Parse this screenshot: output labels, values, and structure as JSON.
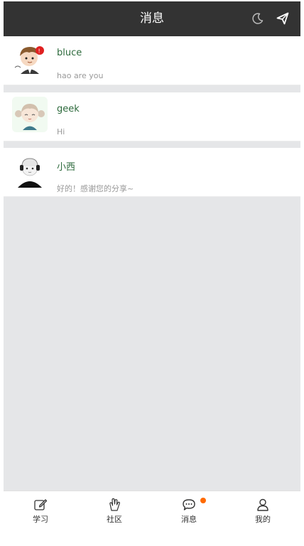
{
  "header": {
    "title": "消息",
    "night_icon": "moon-icon",
    "send_icon": "paper-plane-icon"
  },
  "messages": [
    {
      "name": "bluce",
      "preview": "hao are you",
      "avatar": "cartoon-boy-avatar"
    },
    {
      "name": "geek",
      "preview": "Hi",
      "avatar": "cartoon-girl-avatar"
    },
    {
      "name": "小西",
      "preview": "好的！感谢您的分享~",
      "avatar": "cartoon-headphone-avatar"
    }
  ],
  "tabbar": {
    "tabs": [
      {
        "label": "学习",
        "icon": "edit-icon"
      },
      {
        "label": "社区",
        "icon": "hand-icon"
      },
      {
        "label": "消息",
        "icon": "chat-bubble-icon",
        "badge": true
      },
      {
        "label": "我的",
        "icon": "user-icon"
      }
    ]
  },
  "colors": {
    "header_bg": "#333333",
    "page_bg": "#e5e6e8",
    "name_text": "#2d6a3c",
    "badge": "#ff6a00"
  }
}
